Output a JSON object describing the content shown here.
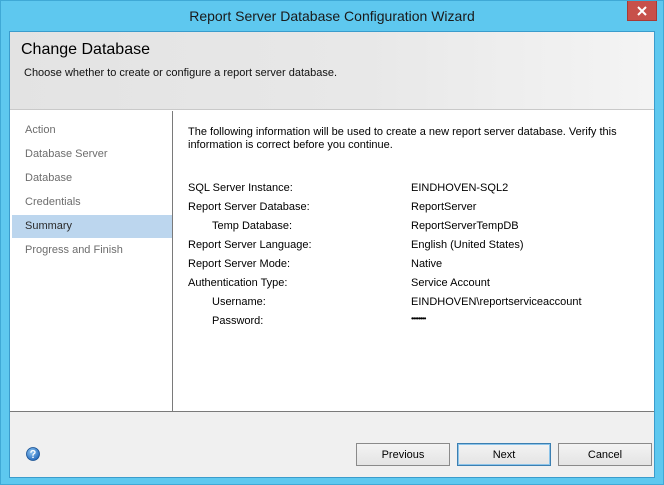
{
  "window": {
    "title": "Report Server Database Configuration Wizard"
  },
  "header": {
    "title": "Change Database",
    "subtitle": "Choose whether to create or configure a report server database."
  },
  "nav": {
    "items": [
      {
        "label": "Action",
        "active": false
      },
      {
        "label": "Database Server",
        "active": false
      },
      {
        "label": "Database",
        "active": false
      },
      {
        "label": "Credentials",
        "active": false
      },
      {
        "label": "Summary",
        "active": true
      },
      {
        "label": "Progress and Finish",
        "active": false
      }
    ]
  },
  "summary": {
    "intro": "The following information will be used to create a new report server database. Verify this information is correct before you continue.",
    "rows": [
      {
        "label": "SQL Server Instance:",
        "value": "EINDHOVEN-SQL2"
      },
      {
        "label": "Report Server Database:",
        "value": "ReportServer"
      },
      {
        "label": "Temp Database:",
        "value": "ReportServerTempDB"
      },
      {
        "label": "Report Server Language:",
        "value": "English (United States)"
      },
      {
        "label": "Report Server Mode:",
        "value": "Native"
      },
      {
        "label": "Authentication Type:",
        "value": "Service Account"
      },
      {
        "label": "Username:",
        "value": "EINDHOVEN\\reportserviceaccount"
      },
      {
        "label": "Password:",
        "value": "••••••••"
      }
    ]
  },
  "footer": {
    "previous_label": "Previous",
    "next_label": "Next",
    "cancel_label": "Cancel"
  },
  "colors": {
    "titlebar": "#5ec8ef",
    "nav_active": "#bcd6ee",
    "close_button": "#c7504a"
  },
  "icons": {
    "close": "close-icon",
    "help": "help-icon"
  }
}
